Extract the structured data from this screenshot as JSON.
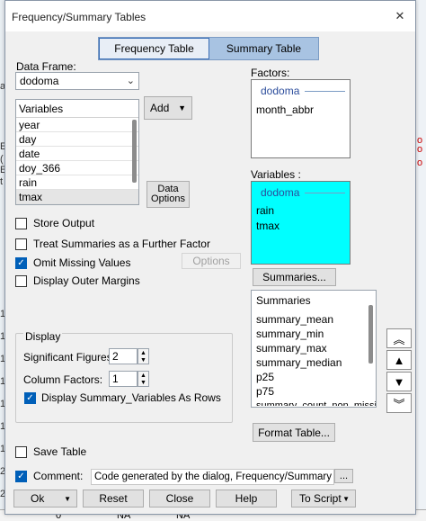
{
  "window": {
    "title": "Frequency/Summary Tables"
  },
  "tabs": [
    {
      "label": "Frequency Table",
      "active": true
    },
    {
      "label": "Summary Table",
      "active": false
    }
  ],
  "data_frame": {
    "label": "Data Frame:",
    "value": "dodoma"
  },
  "variables": {
    "header": "Variables",
    "items": [
      "year",
      "day",
      "date",
      "doy_366",
      "rain",
      "tmax"
    ]
  },
  "buttons": {
    "add": "Add",
    "data_options": [
      "Data",
      "Options"
    ],
    "options": "Options",
    "summaries": "Summaries...",
    "format_table": "Format Table...",
    "ellipsis": "...",
    "ok": "Ok",
    "reset": "Reset",
    "close": "Close",
    "help": "Help",
    "to_script": "To Script"
  },
  "checkboxes": {
    "store_output": {
      "label": "Store Output",
      "checked": false
    },
    "treat_summaries": {
      "label": "Treat Summaries as a Further Factor",
      "checked": false
    },
    "omit_missing": {
      "label": "Omit Missing Values",
      "checked": true
    },
    "display_outer_margins": {
      "label": "Display Outer Margins",
      "checked": false
    },
    "display_summary_rows": {
      "label": "Display Summary_Variables As Rows",
      "checked": true
    },
    "save_table": {
      "label": "Save Table",
      "checked": false
    },
    "comment": {
      "label": "Comment:",
      "checked": true
    }
  },
  "factors": {
    "label": "Factors:",
    "dataframe": "dodoma",
    "items": [
      "month_abbr"
    ]
  },
  "variables_receiver": {
    "label": "Variables :",
    "dataframe": "dodoma",
    "items": [
      "rain",
      "tmax"
    ],
    "bg": "#00ffff"
  },
  "summaries": {
    "header": "Summaries",
    "items": [
      "summary_mean",
      "summary_min",
      "summary_max",
      "summary_median",
      "p25",
      "p75",
      "summary_count_non_missi"
    ]
  },
  "display": {
    "label": "Display",
    "sig_figures": {
      "label": "Significant Figures:",
      "value": "2"
    },
    "column_factors": {
      "label": "Column Factors:",
      "value": "1"
    }
  },
  "comment_text": "Code generated by the dialog, Frequency/Summary Tables",
  "background": {
    "left_chars": [
      "a",
      "",
      "",
      "E",
      "(",
      "E",
      "t",
      "",
      "",
      "",
      "",
      "1",
      "1",
      "1",
      "1",
      "1",
      "1",
      "1",
      "2",
      "2"
    ],
    "right_chars": [
      "o",
      "o",
      "o"
    ],
    "bottom_cells": [
      "0",
      "NA",
      "NA"
    ]
  },
  "colors": {
    "accent": "#005fb8",
    "tab_border": "#3b6fb6",
    "receiver_highlight": "#00ffff"
  }
}
